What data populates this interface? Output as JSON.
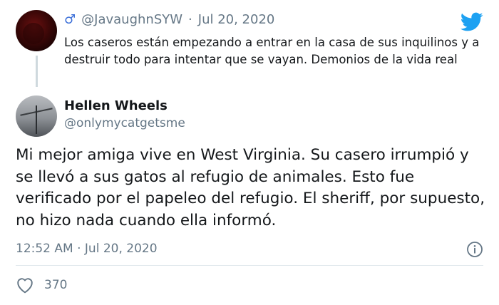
{
  "parent_tweet": {
    "handle": "@JavaughnSYW",
    "separator": "·",
    "date": "Jul 20, 2020",
    "text": "Los caseros están empezando a entrar en la casa de sus inquilinos y a destruir todo para intentar que se vayan. Demonios de la vida real",
    "badge_icon": "male-sign-icon"
  },
  "main_tweet": {
    "display_name": "Hellen Wheels",
    "handle": "@onlymycatgetsme",
    "text": "Mi mejor amiga vive en West Virginia. Su casero irrumpió y se llevó a sus gatos al refugio de animales. Esto fue verificado por el papeleo del refugio. El sheriff, por supuesto, no hizo nada cuando ella informó.",
    "timestamp": "12:52 AM · Jul 20, 2020",
    "likes": "370"
  },
  "colors": {
    "twitter_blue": "#1da1f2",
    "secondary_text": "#657786",
    "divider": "#e1e8ed"
  },
  "icons": [
    "twitter-bird-icon",
    "info-icon",
    "heart-icon",
    "male-sign-icon"
  ]
}
